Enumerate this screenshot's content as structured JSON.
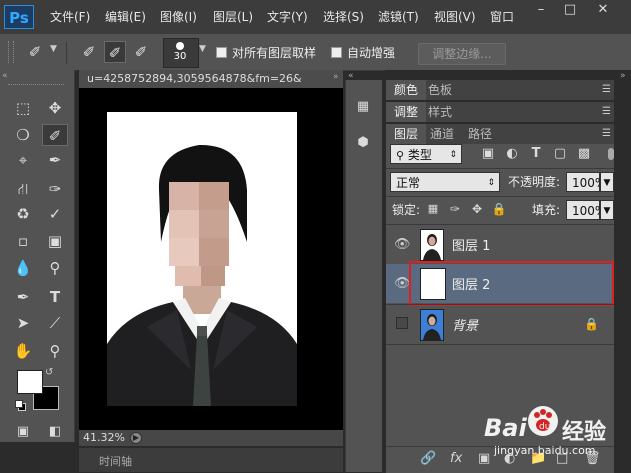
{
  "app": {
    "logo": "Ps"
  },
  "menu": [
    "文件(F)",
    "编辑(E)",
    "图像(I)",
    "图层(L)",
    "文字(Y)",
    "选择(S)",
    "滤镜(T)",
    "视图(V)",
    "窗口"
  ],
  "window_controls": [
    "minimize-icon",
    "restore-icon",
    "close-icon"
  ],
  "options": {
    "brush_size": "30",
    "sample_all_layers": {
      "label": "对所有图层取样",
      "checked": false
    },
    "auto_enhance": {
      "label": "自动增强",
      "checked": false
    },
    "refine_edge_label": "调整边缘..."
  },
  "document": {
    "tab_title": "u=4258752894,3059564878&fm=26&",
    "zoom": "41.32%",
    "timeline_label": "时间轴"
  },
  "panels": {
    "color_group": [
      "颜色",
      "色板"
    ],
    "adjust_group": [
      "调整",
      "样式"
    ],
    "layers_group": [
      "图层",
      "通道",
      "路径"
    ],
    "filter_kind": "类型",
    "blend_mode": "正常",
    "opacity_label": "不透明度:",
    "opacity_value": "100%",
    "lock_label": "锁定:",
    "fill_label": "填充:",
    "fill_value": "100%"
  },
  "layers": [
    {
      "name": "图层 1",
      "visible": true,
      "selected": false,
      "thumb": "photo"
    },
    {
      "name": "图层 2",
      "visible": true,
      "selected": true,
      "thumb": "white"
    },
    {
      "name": "背景",
      "visible": false,
      "selected": false,
      "thumb": "photo",
      "locked": true
    }
  ],
  "watermark": {
    "brand": "Bai",
    "brand2": "经验",
    "url": "jingyan.baidu.com"
  },
  "colors": {
    "accent": "#31a8ff",
    "highlight": "#e02020",
    "selected_layer": "#5a6a80"
  }
}
